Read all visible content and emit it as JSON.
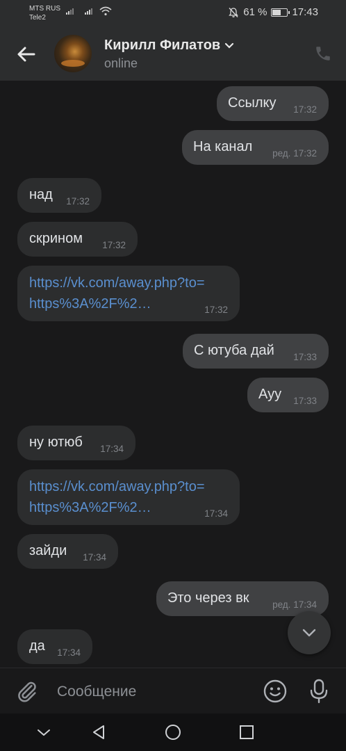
{
  "status_bar": {
    "carrier1": "MTS RUS",
    "carrier2": "Tele2",
    "battery_text": "61 %",
    "battery_level": 0.61,
    "time": "17:43"
  },
  "header": {
    "contact_name": "Кирилл Филатов",
    "status": "online"
  },
  "messages": [
    {
      "dir": "out",
      "text": "Ссылку",
      "time": "17:32",
      "edited": ""
    },
    {
      "dir": "out",
      "text": "На канал",
      "time": "17:32",
      "edited": "ред."
    },
    {
      "dir": "in",
      "text": "над",
      "time": "17:32",
      "edited": ""
    },
    {
      "dir": "in",
      "text": "скрином",
      "time": "17:32",
      "edited": ""
    },
    {
      "dir": "in",
      "link1": "https://vk.com/away.php?to=",
      "link2": "https%3A%2F%2…",
      "time": "17:32",
      "edited": ""
    },
    {
      "dir": "out",
      "text": "С ютуба дай",
      "time": "17:33",
      "edited": ""
    },
    {
      "dir": "out",
      "text": "Ауу",
      "time": "17:33",
      "edited": ""
    },
    {
      "dir": "in",
      "text": "ну ютюб",
      "time": "17:34",
      "edited": ""
    },
    {
      "dir": "in",
      "link1": "https://vk.com/away.php?to=",
      "link2": "https%3A%2F%2…",
      "time": "17:34",
      "edited": ""
    },
    {
      "dir": "in",
      "text": "зайди",
      "time": "17:34",
      "edited": ""
    },
    {
      "dir": "out",
      "text": "Это через вк",
      "time": "17:34",
      "edited": "ред."
    },
    {
      "dir": "in",
      "text": "да",
      "time": "17:34",
      "edited": ""
    }
  ],
  "composer": {
    "placeholder": "Сообщение"
  },
  "icons": {
    "back": "arrow-left-icon",
    "chevron": "chevron-down-icon",
    "phone": "phone-icon",
    "scroll": "chevron-down-icon",
    "attach": "paperclip-icon",
    "emoji": "smiley-icon",
    "mic": "microphone-icon"
  }
}
